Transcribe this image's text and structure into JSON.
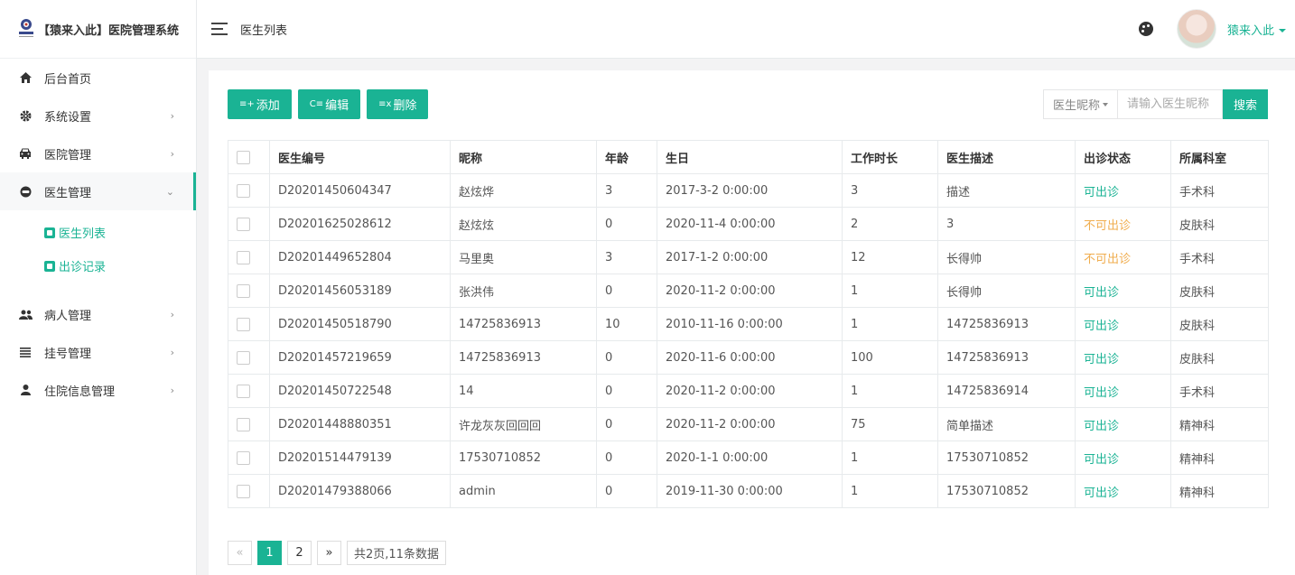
{
  "brand": {
    "logo_text": "猿来入此",
    "title": "【猿来入此】医院管理系统"
  },
  "sidebar": {
    "items": [
      {
        "label": "后台首页",
        "icon": "home-icon"
      },
      {
        "label": "系统设置",
        "icon": "gear-icon"
      },
      {
        "label": "医院管理",
        "icon": "car-icon"
      },
      {
        "label": "医生管理",
        "icon": "doctor-icon"
      },
      {
        "label": "病人管理",
        "icon": "people-icon"
      },
      {
        "label": "挂号管理",
        "icon": "list-icon"
      },
      {
        "label": "住院信息管理",
        "icon": "person-icon"
      }
    ],
    "submenu": [
      {
        "label": "医生列表",
        "icon": "id-card-icon"
      },
      {
        "label": "出诊记录",
        "icon": "folder-icon"
      }
    ]
  },
  "header": {
    "page_title": "医生列表",
    "username": "猿来入此"
  },
  "toolbar": {
    "add_label": "添加",
    "edit_label": "编辑",
    "delete_label": "删除"
  },
  "search": {
    "field_label": "医生昵称",
    "placeholder": "请输入医生昵称",
    "button_label": "搜索"
  },
  "table": {
    "headers": [
      "医生编号",
      "昵称",
      "年龄",
      "生日",
      "工作时长",
      "医生描述",
      "出诊状态",
      "所属科室"
    ],
    "rows": [
      {
        "id": "D20201450604347",
        "nickname": "赵炫烨",
        "age": "3",
        "birthday": "2017-3-2 0:00:00",
        "work": "3",
        "desc": "描述",
        "status": "可出诊",
        "dept": "手术科"
      },
      {
        "id": "D20201625028612",
        "nickname": "赵炫炫",
        "age": "0",
        "birthday": "2020-11-4 0:00:00",
        "work": "2",
        "desc": "3",
        "status": "不可出诊",
        "dept": "皮肤科"
      },
      {
        "id": "D20201449652804",
        "nickname": "马里奥",
        "age": "3",
        "birthday": "2017-1-2 0:00:00",
        "work": "12",
        "desc": "长得帅",
        "status": "不可出诊",
        "dept": "手术科"
      },
      {
        "id": "D20201456053189",
        "nickname": "张洪伟",
        "age": "0",
        "birthday": "2020-11-2 0:00:00",
        "work": "1",
        "desc": "长得帅",
        "status": "可出诊",
        "dept": "皮肤科"
      },
      {
        "id": "D20201450518790",
        "nickname": "14725836913",
        "age": "10",
        "birthday": "2010-11-16 0:00:00",
        "work": "1",
        "desc": "14725836913",
        "status": "可出诊",
        "dept": "皮肤科"
      },
      {
        "id": "D20201457219659",
        "nickname": "14725836913",
        "age": "0",
        "birthday": "2020-11-6 0:00:00",
        "work": "100",
        "desc": "14725836913",
        "status": "可出诊",
        "dept": "皮肤科"
      },
      {
        "id": "D20201450722548",
        "nickname": "14",
        "age": "0",
        "birthday": "2020-11-2 0:00:00",
        "work": "1",
        "desc": "14725836914",
        "status": "可出诊",
        "dept": "手术科"
      },
      {
        "id": "D20201448880351",
        "nickname": "许龙灰灰回回回",
        "age": "0",
        "birthday": "2020-11-2 0:00:00",
        "work": "75",
        "desc": "简单描述",
        "status": "可出诊",
        "dept": "精神科"
      },
      {
        "id": "D20201514479139",
        "nickname": "17530710852",
        "age": "0",
        "birthday": "2020-1-1 0:00:00",
        "work": "1",
        "desc": "17530710852",
        "status": "可出诊",
        "dept": "精神科"
      },
      {
        "id": "D20201479388066",
        "nickname": "admin",
        "age": "0",
        "birthday": "2019-11-30 0:00:00",
        "work": "1",
        "desc": "17530710852",
        "status": "可出诊",
        "dept": "精神科"
      }
    ]
  },
  "pagination": {
    "prev": "«",
    "pages": [
      "1",
      "2"
    ],
    "next": "»",
    "info": "共2页,11条数据"
  },
  "colors": {
    "accent": "#1ab394",
    "unavailable": "#f0ad4e"
  }
}
